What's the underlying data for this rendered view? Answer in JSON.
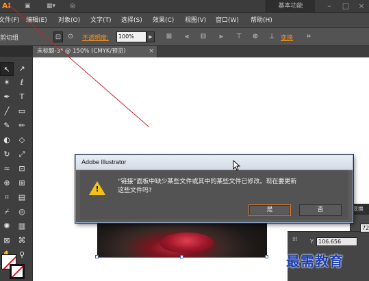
{
  "app": {
    "logo": "AI",
    "workspace": "基本功能"
  },
  "menu": [
    "文件(F)",
    "编辑(E)",
    "对象(O)",
    "文字(T)",
    "选择(S)",
    "效果(C)",
    "视图(V)",
    "窗口(W)",
    "帮助(H)"
  ],
  "control_bar": {
    "selection_label": "剪切组",
    "opacity_label": "不透明度:",
    "opacity_value": "100%",
    "transform_label": "变换"
  },
  "document_tab": {
    "title": "未标题-3* @ 150% (CMYK/预览)",
    "close": "×"
  },
  "dialog": {
    "title": "Adobe Illustrator",
    "message_line1": "“链接”面板中缺少某些文件或其中的某些文件已修改。现在要更新",
    "message_line2": "这些文件吗?",
    "yes_label": "是",
    "no_label": "否"
  },
  "transform_panel": {
    "panel_head": "变换",
    "x_field_value": "72",
    "y_label": "Y:",
    "y_value": "106.656"
  },
  "watermark": "最需教育",
  "colors": {
    "accent_orange": "#f7931e",
    "warning_yellow": "#f4c21a",
    "annotation_red": "#c0232a"
  }
}
